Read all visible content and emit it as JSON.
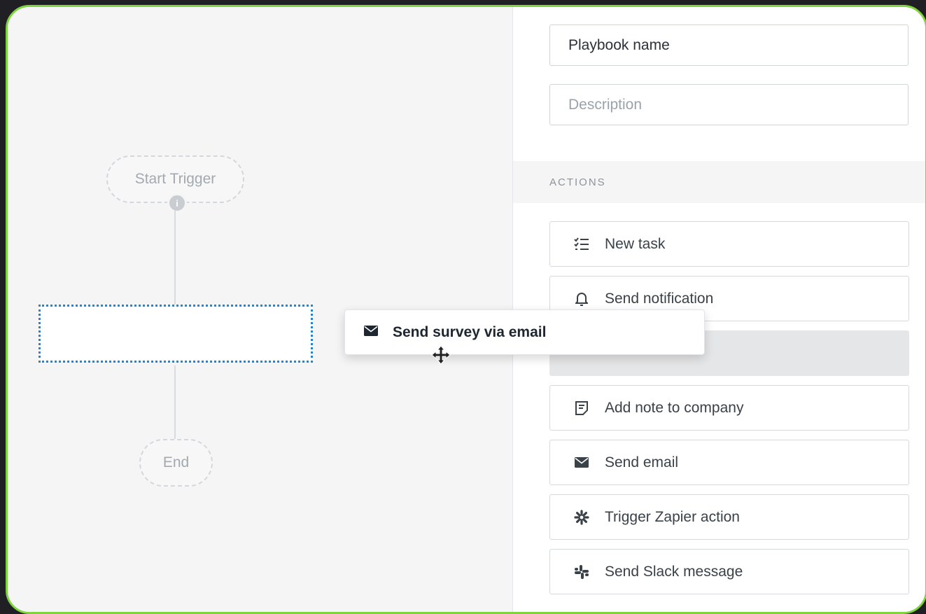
{
  "canvas": {
    "start_node": "Start Trigger",
    "end_node": "End",
    "dragging_card": {
      "label": "Send survey via email",
      "icon": "envelope-icon"
    }
  },
  "panel": {
    "playbook_name": {
      "value": "Playbook name",
      "placeholder": ""
    },
    "description": {
      "value": "",
      "placeholder": "Description"
    },
    "actions_header": "ACTIONS",
    "actions": [
      {
        "label": "New task",
        "icon": "task-list-icon"
      },
      {
        "label": "Send notification",
        "icon": "bell-icon"
      },
      {
        "label": "Add note to company",
        "icon": "note-icon"
      },
      {
        "label": "Send email",
        "icon": "envelope-icon"
      },
      {
        "label": "Trigger Zapier action",
        "icon": "zapier-icon"
      },
      {
        "label": "Send Slack message",
        "icon": "slack-icon"
      }
    ]
  },
  "colors": {
    "frame_border": "#7ed43c",
    "drop_zone_border": "#2f80c9",
    "background": "#1f1f24"
  }
}
